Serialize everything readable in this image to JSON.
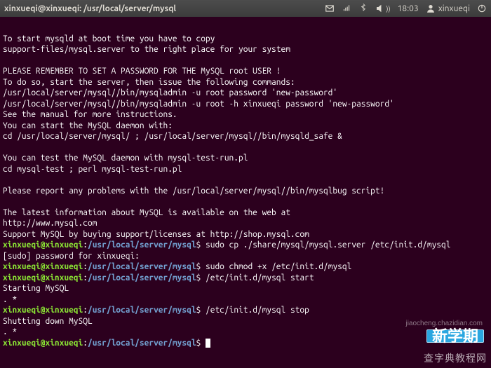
{
  "panel": {
    "title": "xinxueqi@xinxueqi: /usr/local/server/mysql",
    "time": "18:03",
    "username": "xinxueqi"
  },
  "prompt": {
    "userhost": "xinxueqi@xinxueqi",
    "sep": ":",
    "path": "/usr/local/server/mysql",
    "dollar": "$"
  },
  "lines": {
    "l01": "To start mysqld at boot time you have to copy",
    "l02": "support-files/mysql.server to the right place for your system",
    "l03": "",
    "l04": "PLEASE REMEMBER TO SET A PASSWORD FOR THE MySQL root USER !",
    "l05": "To do so, start the server, then issue the following commands:",
    "l06": "/usr/local/server/mysql//bin/mysqladmin -u root password 'new-password'",
    "l07": "/usr/local/server/mysql//bin/mysqladmin -u root -h xinxueqi password 'new-password'",
    "l08": "See the manual for more instructions.",
    "l09": "You can start the MySQL daemon with:",
    "l10": "cd /usr/local/server/mysql/ ; /usr/local/server/mysql//bin/mysqld_safe &",
    "l11": "",
    "l12": "You can test the MySQL daemon with mysql-test-run.pl",
    "l13": "cd mysql-test ; perl mysql-test-run.pl",
    "l14": "",
    "l15": "Please report any problems with the /usr/local/server/mysql//bin/mysqlbug script!",
    "l16": "",
    "l17": "The latest information about MySQL is available on the web at",
    "l18": "http://www.mysql.com",
    "l19": "Support MySQL by buying support/licenses at http://shop.mysql.com",
    "cmd1": " sudo cp ./share/mysql/mysql.server /etc/init.d/mysql",
    "l21": "[sudo] password for xinxueqi:",
    "cmd2": " sudo chmod +x /etc/init.d/mysql",
    "cmd3": " /etc/init.d/mysql start",
    "l24": "Starting MySQL",
    "l25": ". *",
    "cmd4": " /etc/init.d/mysql stop",
    "l27": "Shutting down MySQL",
    "l28": ". *"
  },
  "watermarks": {
    "w1": "新学期",
    "w2": "查字典教程网",
    "w3": "jiaocheng.chazidian.com"
  }
}
